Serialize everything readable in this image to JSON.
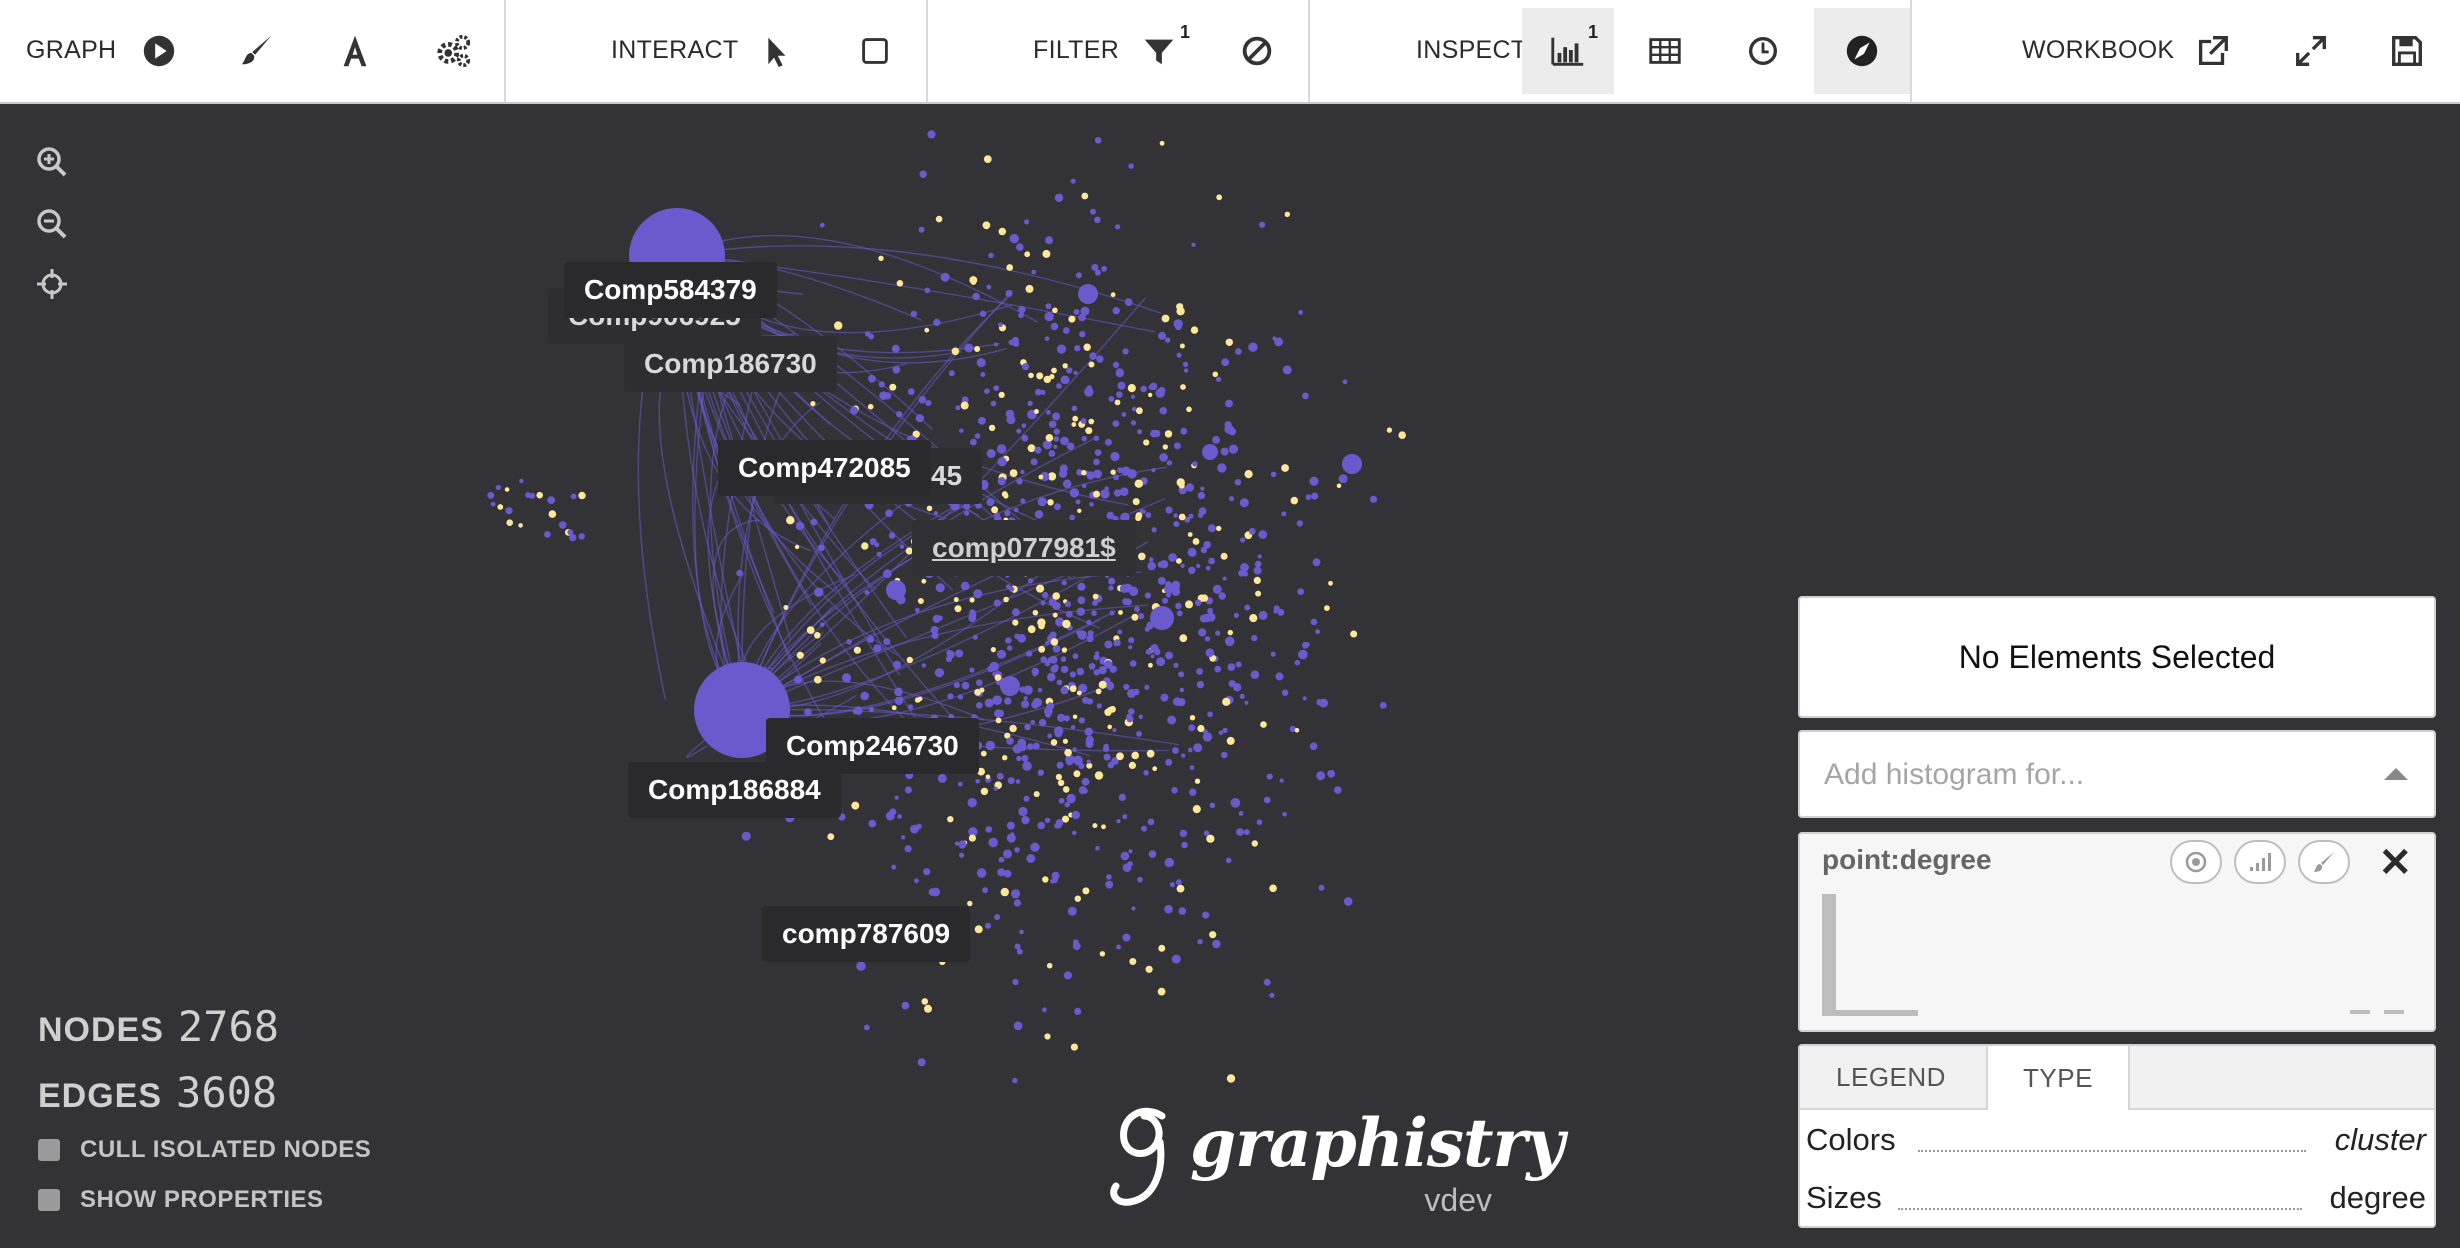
{
  "toolbar": {
    "graph_label": "GRAPH",
    "interact_label": "INTERACT",
    "filter_label": "FILTER",
    "filter_badge": "1",
    "inspect_label": "INSPECT",
    "inspect_badge": "1",
    "workbook_label": "WORKBOOK",
    "icons": [
      "play-icon",
      "brush-icon",
      "font-icon",
      "gears-icon",
      "pointer-icon",
      "square-select-icon",
      "funnel-icon",
      "ban-icon",
      "histogram-icon",
      "table-icon",
      "clock-icon",
      "compass-icon",
      "external-link-icon",
      "expand-icon",
      "save-icon"
    ]
  },
  "graph": {
    "node_color": "#6a5acd",
    "highlight_color": "#ffe79a",
    "labels": {
      "comp584379": "Comp584379",
      "comp906925": "Comp906925",
      "comp186730": "Comp186730",
      "comp472085": "Comp472085",
      "comp052745": "comp052745",
      "comp077981": "comp077981$",
      "comp246730": "Comp246730",
      "comp186884": "Comp186884",
      "comp787609": "comp787609"
    }
  },
  "stats": {
    "nodes_label": "NODES",
    "nodes_value": "2768",
    "edges_label": "EDGES",
    "edges_value": "3608",
    "cull_label": "CULL ISOLATED NODES",
    "props_label": "SHOW PROPERTIES"
  },
  "logo": {
    "brand": "graphistry",
    "version": "vdev"
  },
  "panel": {
    "selection_text": "No Elements Selected",
    "histogram_placeholder": "Add histogram for...",
    "histogram_title": "point:degree",
    "tabs": [
      "LEGEND",
      "TYPE"
    ],
    "active_tab": "TYPE",
    "legend": [
      {
        "key": "Colors",
        "value": "cluster"
      },
      {
        "key": "Sizes",
        "value": "degree"
      }
    ]
  }
}
